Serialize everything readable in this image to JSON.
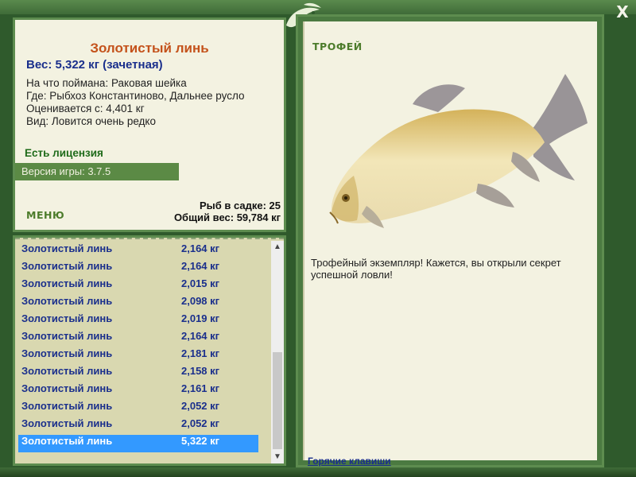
{
  "close_label": "X",
  "fish": {
    "name": "Золотистый линь",
    "weight_line": "Вес: 5,322 кг (зачетная)",
    "bait_line": "На что поймана: Раковая шейка",
    "place_line": "Где: Рыбхоз Константиново, Дальнее русло",
    "valued_line": "Оценивается с: 4,401 кг",
    "species_line": "Вид: Ловится очень редко"
  },
  "license": "Есть лицензия",
  "version": "Версия игры: 3.7.5",
  "menu_label": "МЕНЮ",
  "cage": {
    "count": "Рыб в садке: 25",
    "total": "Общий вес: 59,784 кг"
  },
  "catch_list": [
    {
      "name": "Золотистый линь",
      "weight": "2,164 кг"
    },
    {
      "name": "Золотистый линь",
      "weight": "2,164 кг"
    },
    {
      "name": "Золотистый линь",
      "weight": "2,015 кг"
    },
    {
      "name": "Золотистый линь",
      "weight": "2,098 кг"
    },
    {
      "name": "Золотистый линь",
      "weight": "2,019 кг"
    },
    {
      "name": "Золотистый линь",
      "weight": "2,164 кг"
    },
    {
      "name": "Золотистый линь",
      "weight": "2,181 кг"
    },
    {
      "name": "Золотистый линь",
      "weight": "2,158 кг"
    },
    {
      "name": "Золотистый линь",
      "weight": "2,161 кг"
    },
    {
      "name": "Золотистый линь",
      "weight": "2,052 кг"
    },
    {
      "name": "Золотистый линь",
      "weight": "2,052 кг"
    },
    {
      "name": "Золотистый линь",
      "weight": "5,322 кг",
      "selected": true
    }
  ],
  "trophy": {
    "label": "ТРОФЕЙ",
    "text": "Трофейный экземпляр! Кажется, вы открыли секрет успешной ловли!",
    "hotkeys": "Горячие клавиши"
  },
  "colors": {
    "frame": "#2f5a2c",
    "panel": "#f3f2e1",
    "accent_green": "#5b8a45",
    "title_orange": "#c4521b",
    "text_blue": "#1a2f8c",
    "selection": "#3399ff"
  },
  "icons": {
    "close": "close-icon",
    "logo": "fish-logo-icon",
    "scroll_up": "chevron-up-icon",
    "scroll_down": "chevron-down-icon"
  }
}
